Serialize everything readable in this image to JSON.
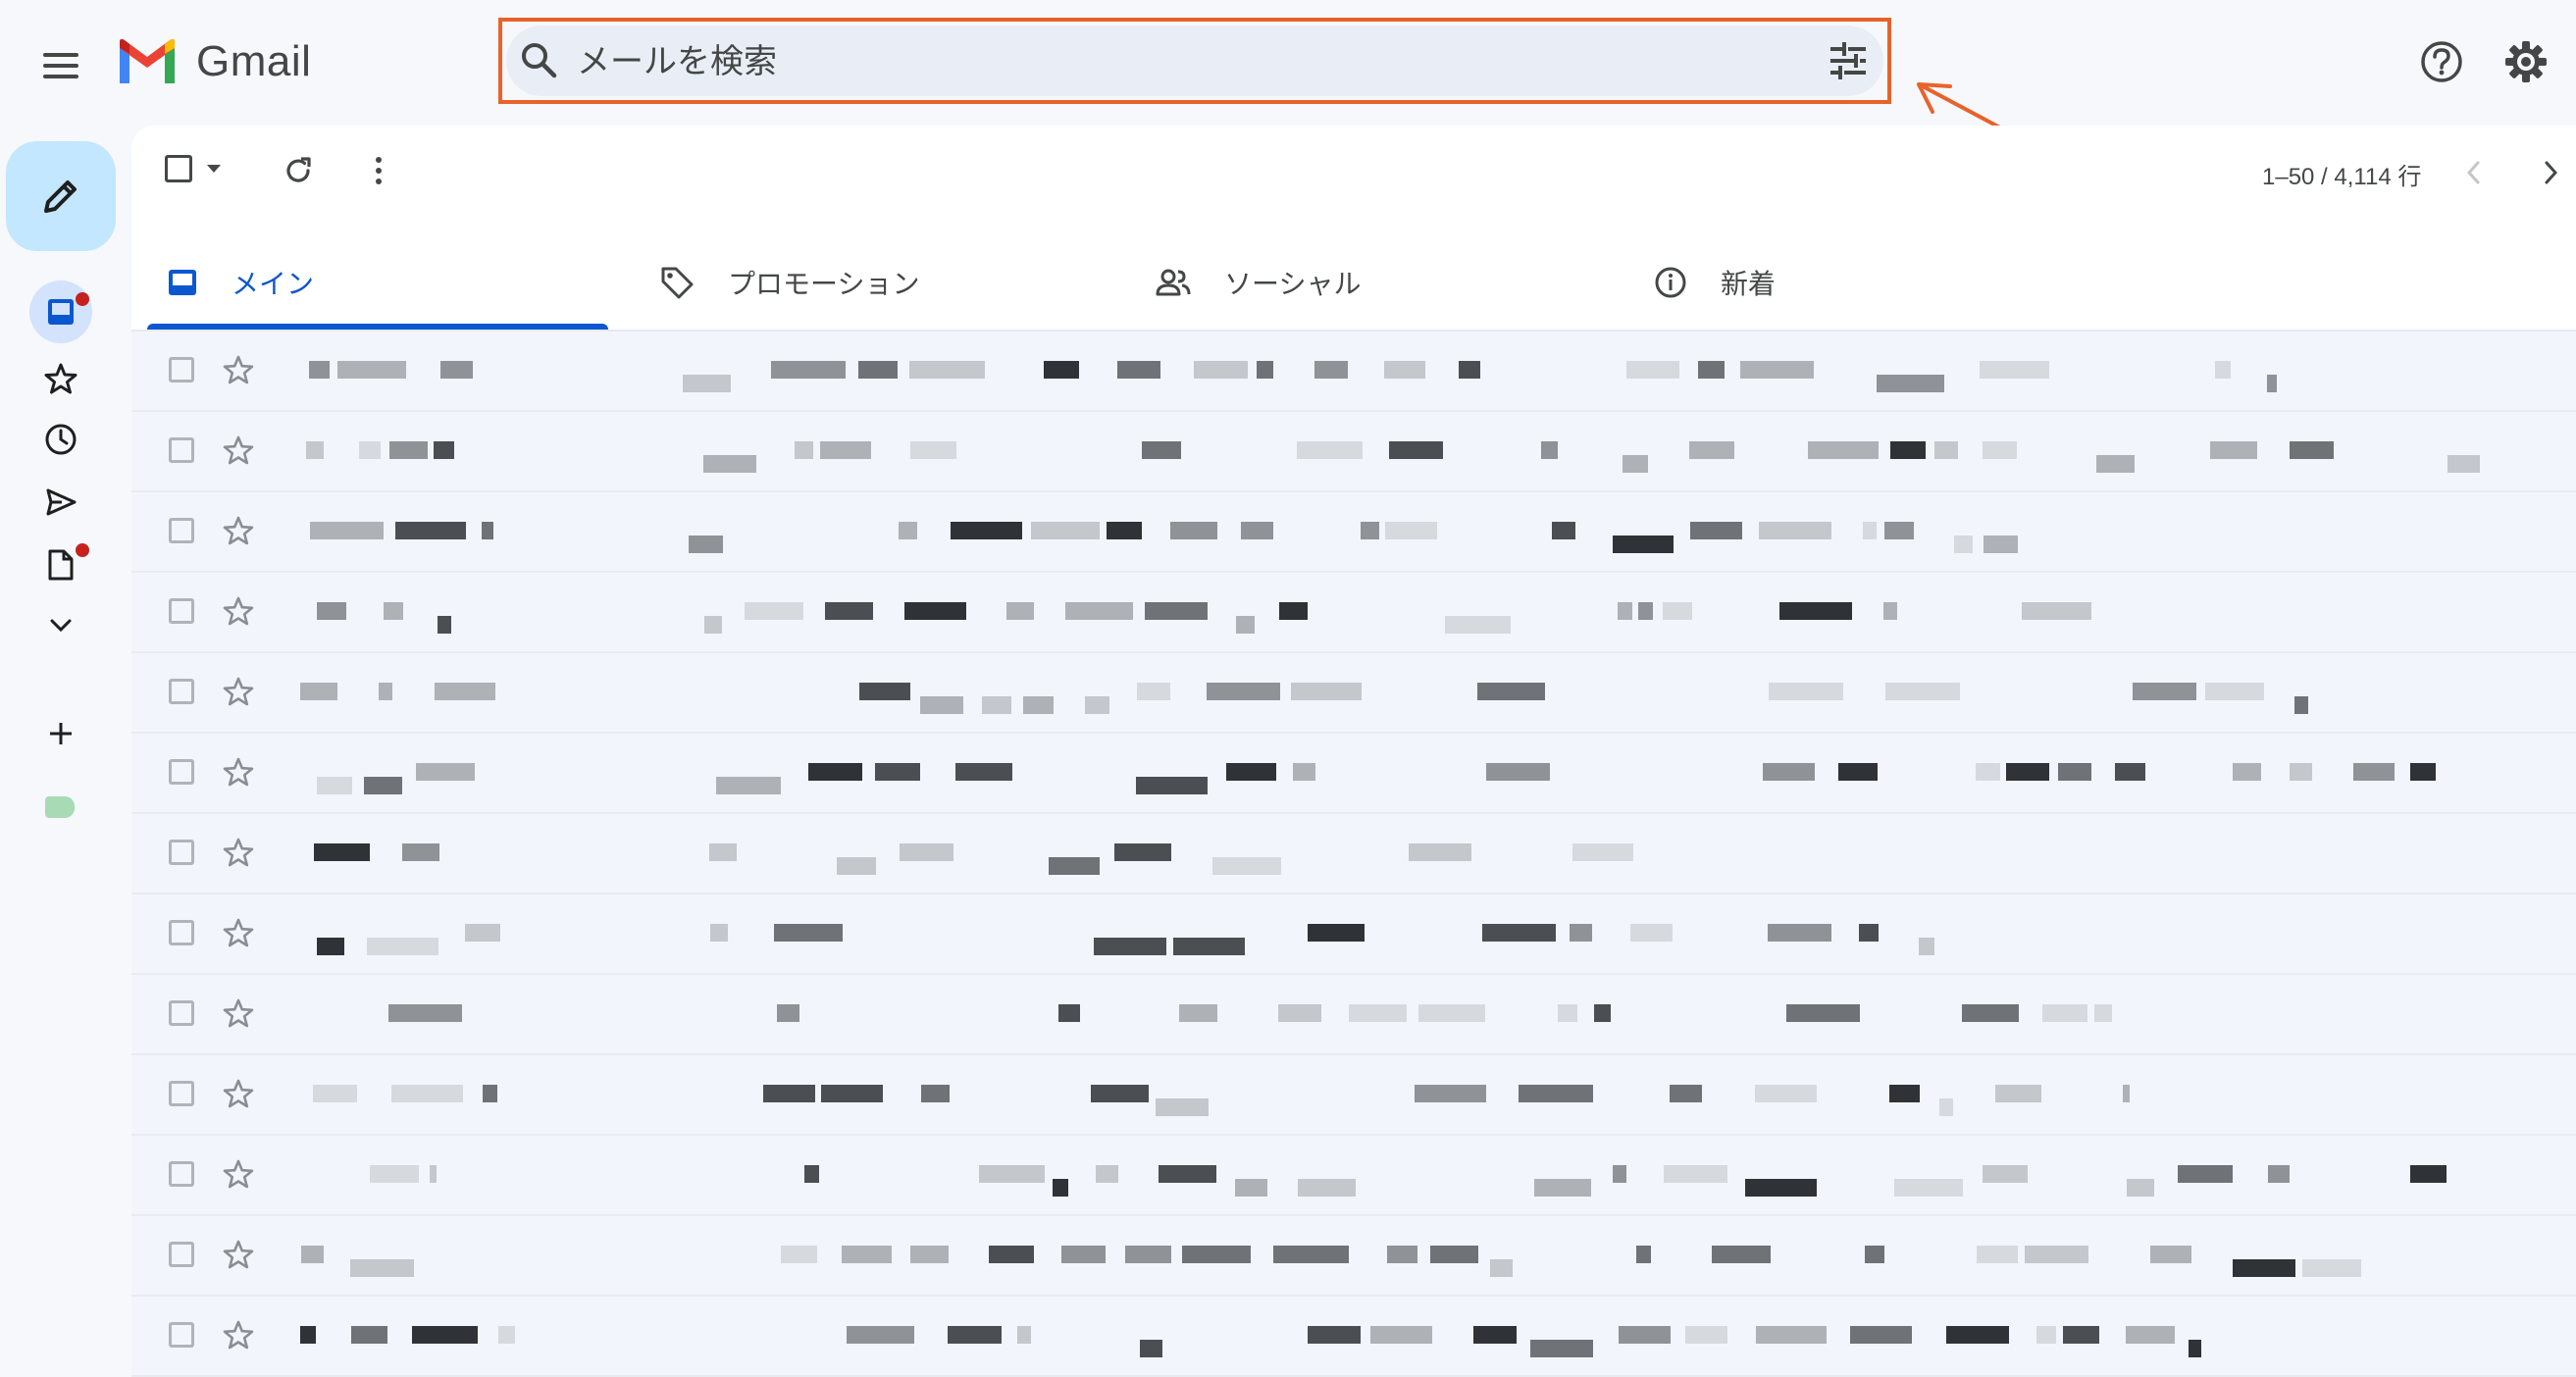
{
  "app": {
    "name": "Gmail",
    "brand_colors": {
      "red": "#ea4335",
      "blue": "#4285f4",
      "green": "#34a853",
      "yellow": "#fbbc04",
      "annotation": "#e8632b"
    }
  },
  "header": {
    "menu_icon": "hamburger-menu-icon",
    "logo_text": "Gmail",
    "search": {
      "placeholder": "メールを検索",
      "value": "",
      "icon": "search-icon",
      "filter_icon": "tune-icon"
    },
    "help_icon": "help-icon",
    "settings_icon": "gear-icon"
  },
  "toolbar": {
    "pagination": "1–50 / 4,114 行"
  },
  "tabs": [
    {
      "label": "メイン",
      "icon": "inbox-icon",
      "active": true
    },
    {
      "label": "プロモーション",
      "icon": "tag-icon",
      "active": false
    },
    {
      "label": "ソーシャル",
      "icon": "people-icon",
      "active": false
    },
    {
      "label": "新着",
      "icon": "info-icon",
      "active": false
    }
  ],
  "sidebar": {
    "items": [
      {
        "icon": "pencil-icon",
        "role": "compose"
      },
      {
        "icon": "inbox-icon",
        "badge": true
      },
      {
        "icon": "star-icon"
      },
      {
        "icon": "clock-icon"
      },
      {
        "icon": "send-icon"
      },
      {
        "icon": "document-icon",
        "badge": true
      },
      {
        "icon": "chevron-down-icon"
      },
      {
        "icon": "plus-icon"
      },
      {
        "icon": "label-icon",
        "color": "#a8dab5"
      }
    ]
  },
  "email_list": {
    "row_count": 13,
    "content_blurred": true
  }
}
